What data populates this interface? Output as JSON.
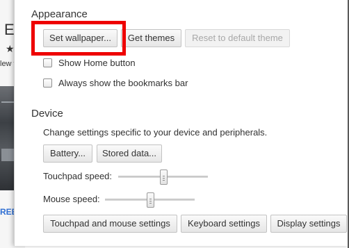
{
  "background_page": {
    "title_fragment": "Ea",
    "star": "★",
    "text_fragment": "lew t",
    "banner_fragment": "REE"
  },
  "appearance": {
    "title": "Appearance",
    "buttons": {
      "set_wallpaper": "Set wallpaper...",
      "get_themes": "Get themes",
      "reset_theme": "Reset to default theme"
    },
    "reset_theme_enabled": false,
    "set_wallpaper_highlighted": true,
    "checkboxes": [
      {
        "label": "Show Home button",
        "checked": false
      },
      {
        "label": "Always show the bookmarks bar",
        "checked": false
      }
    ]
  },
  "device": {
    "title": "Device",
    "description": "Change settings specific to your device and peripherals.",
    "buttons": {
      "battery": "Battery...",
      "stored_data": "Stored data..."
    },
    "sliders": {
      "touchpad_label": "Touchpad speed:",
      "touchpad_value": 0.5,
      "mouse_label": "Mouse speed:",
      "mouse_value": 0.5
    },
    "bottom_buttons": {
      "touchpad_mouse": "Touchpad and mouse settings",
      "keyboard": "Keyboard settings",
      "display": "Display settings"
    }
  },
  "colors": {
    "highlight": "#ee0000",
    "panel_bg": "#ffffff",
    "link_blue": "#2f6fd3"
  }
}
